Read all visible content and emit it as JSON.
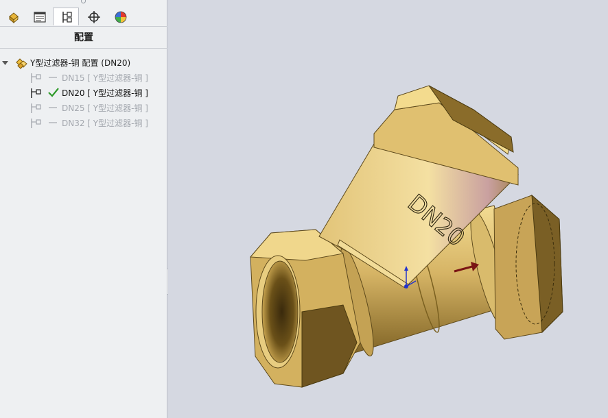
{
  "panel": {
    "title": "配置",
    "tabs": [
      {
        "icon": "feature-manager-icon",
        "active": false
      },
      {
        "icon": "property-manager-icon",
        "active": false
      },
      {
        "icon": "configuration-manager-icon",
        "active": true
      },
      {
        "icon": "dimxpert-icon",
        "active": false
      },
      {
        "icon": "display-manager-icon",
        "active": false
      }
    ]
  },
  "tree": {
    "root_label": "Y型过滤器-铜 配置  (DN20)",
    "configurations": [
      {
        "label": "DN15 [ Y型过滤器-铜 ]",
        "active": false
      },
      {
        "label": "DN20 [ Y型过滤器-铜 ]",
        "active": true
      },
      {
        "label": "DN25 [ Y型过滤器-铜 ]",
        "active": false
      },
      {
        "label": "DN32 [ Y型过滤器-铜 ]",
        "active": false
      }
    ]
  },
  "model": {
    "engraving": "DN20",
    "brass_color": "#c9a85a",
    "flow_arrow_color": "#7a1414",
    "viewport_bg": "#d5d8e1"
  }
}
